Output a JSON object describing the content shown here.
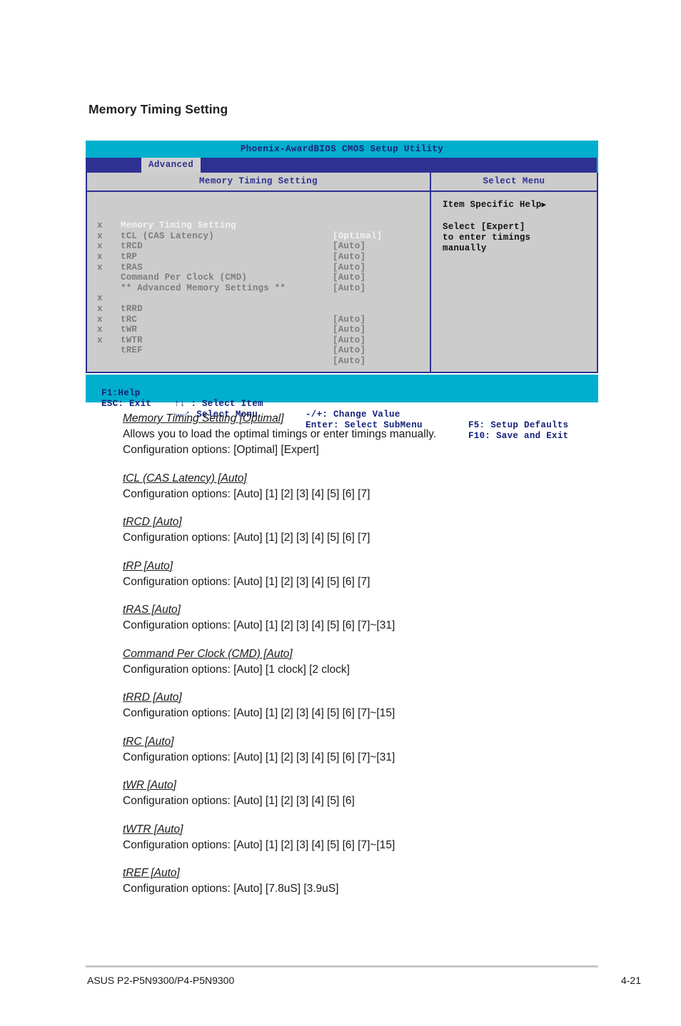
{
  "page": {
    "title": "Memory Timing Setting",
    "footer_left": "ASUS P2-P5N9300/P4-P5N9300",
    "footer_right": "4-21"
  },
  "colors": {
    "bios_header_teal": "#00aecd",
    "bios_menubar_blue": "#2e3192",
    "bios_body_gray": "#cccccc",
    "bios_border_blue": "#2e3192",
    "tab_active_bg": "#d0d0d0",
    "disabled_text": "#7d7d7d",
    "active_text": "#f2f2f2"
  },
  "bios": {
    "utility_title": "Phoenix-AwardBIOS CMOS Setup Utility",
    "active_tab": "Advanced",
    "left_panel_header": "Memory Timing Setting",
    "right_panel_header": "Select Menu",
    "settings": [
      {
        "mark": "",
        "label": "Memory Timing Setting",
        "value": "[Optimal]",
        "active": true
      },
      {
        "mark": "x",
        "label": "tCL (CAS Latency)",
        "value": "[Auto]",
        "active": false
      },
      {
        "mark": "x",
        "label": "tRCD",
        "value": "[Auto]",
        "active": false
      },
      {
        "mark": "x",
        "label": "tRP",
        "value": "[Auto]",
        "active": false
      },
      {
        "mark": "x",
        "label": "tRAS",
        "value": "[Auto]",
        "active": false
      },
      {
        "mark": "x",
        "label": "Command Per Clock (CMD)",
        "value": "[Auto]",
        "active": false
      }
    ],
    "section_label": "** Advanced Memory Settings **",
    "advanced_settings": [
      {
        "mark": "x",
        "label": "tRRD",
        "value": "[Auto]",
        "active": false
      },
      {
        "mark": "x",
        "label": "tRC",
        "value": "[Auto]",
        "active": false
      },
      {
        "mark": "x",
        "label": "tWR",
        "value": "[Auto]",
        "active": false
      },
      {
        "mark": "x",
        "label": "tWTR",
        "value": "[Auto]",
        "active": false
      },
      {
        "mark": "x",
        "label": "tREF",
        "value": "[Auto]",
        "active": false
      }
    ],
    "help": {
      "title": "Item Specific Help",
      "title_arrow": "▶",
      "lines": [
        "Select [Expert]",
        "to enter timings",
        "manually"
      ]
    },
    "legend": {
      "row1": {
        "a": "F1:Help",
        "b": "↑↓ : Select Item",
        "c": "-/+: Change Value",
        "d": "F5: Setup Defaults"
      },
      "row2": {
        "a": "ESC: Exit",
        "b": "→←: Select Menu",
        "c": "Enter: Select SubMenu",
        "d": "F10: Save and Exit"
      }
    }
  },
  "descriptions": [
    {
      "title": "Memory Timing Setting [Optimal]",
      "lines": [
        "Allows you to load the optimal timings or enter timings manually.",
        "Configuration options: [Optimal] [Expert]"
      ]
    },
    {
      "title": "tCL (CAS Latency) [Auto]",
      "lines": [
        "Configuration options: [Auto] [1] [2] [3] [4] [5] [6] [7]"
      ]
    },
    {
      "title": "tRCD [Auto] ",
      "lines": [
        "Configuration options: [Auto] [1] [2] [3] [4] [5] [6] [7]"
      ]
    },
    {
      "title": "tRP [Auto] ",
      "lines": [
        "Configuration options: [Auto] [1] [2] [3] [4] [5] [6] [7]"
      ]
    },
    {
      "title": "tRAS [Auto]",
      "lines": [
        "Configuration options: [Auto] [1] [2] [3] [4] [5] [6] [7]~[31]"
      ]
    },
    {
      "title": "Command Per Clock (CMD) [Auto]",
      "lines": [
        "Configuration options: [Auto] [1 clock] [2 clock]"
      ]
    },
    {
      "title": "tRRD [Auto]",
      "lines": [
        "Configuration options: [Auto] [1] [2] [3] [4] [5] [6] [7]~[15]"
      ]
    },
    {
      "title": "tRC [Auto]",
      "lines": [
        "Configuration options: [Auto] [1] [2] [3] [4] [5] [6] [7]~[31]"
      ]
    },
    {
      "title": "tWR [Auto]",
      "lines": [
        "Configuration options: [Auto] [1] [2] [3] [4] [5] [6]"
      ]
    },
    {
      "title": "tWTR [Auto]",
      "lines": [
        "Configuration options: [Auto] [1] [2] [3] [4] [5] [6] [7]~[15]"
      ]
    },
    {
      "title": "tREF [Auto]",
      "lines": [
        "Configuration options: [Auto] [7.8uS] [3.9uS]"
      ]
    }
  ]
}
